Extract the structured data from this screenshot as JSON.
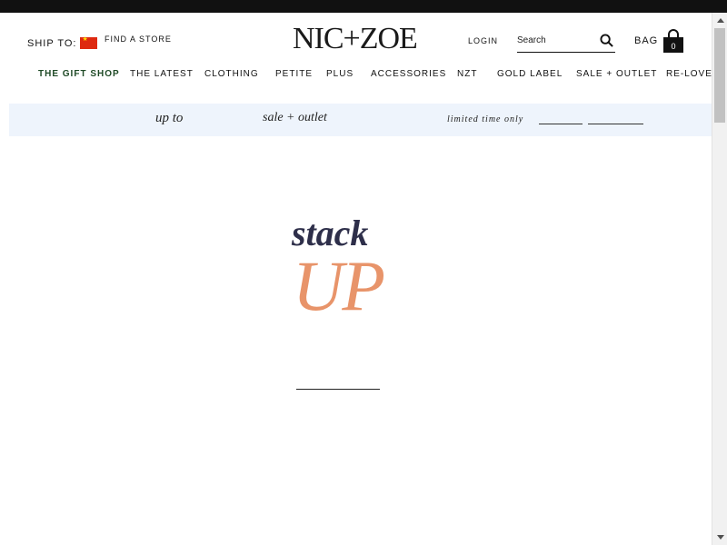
{
  "header": {
    "ship_to_label": "SHIP TO:",
    "find_store": "FIND A STORE",
    "logo": "NIC+ZOE",
    "login": "LOGIN",
    "search_placeholder": "Search",
    "bag_label": "BAG",
    "bag_count": "0"
  },
  "nav": {
    "items": [
      {
        "label": "THE GIFT SHOP"
      },
      {
        "label": "THE LATEST"
      },
      {
        "label": "CLOTHING"
      },
      {
        "label": "PETITE"
      },
      {
        "label": "PLUS"
      },
      {
        "label": "ACCESSORIES"
      },
      {
        "label": "NZT"
      },
      {
        "label": "GOLD LABEL"
      },
      {
        "label": "SALE + OUTLET"
      },
      {
        "label": "RE-LOVED"
      }
    ]
  },
  "promo": {
    "up_to": "up to",
    "sale_outlet": "sale + outlet",
    "limited": "limited time only"
  },
  "hero": {
    "stack": "stack",
    "up": "UP"
  },
  "colors": {
    "gift_shop": "#1f4a26",
    "promo_bg": "#eef4fc",
    "hero_stack": "#2e2f4a",
    "hero_up": "#e8946a",
    "top_bar": "#111111"
  }
}
